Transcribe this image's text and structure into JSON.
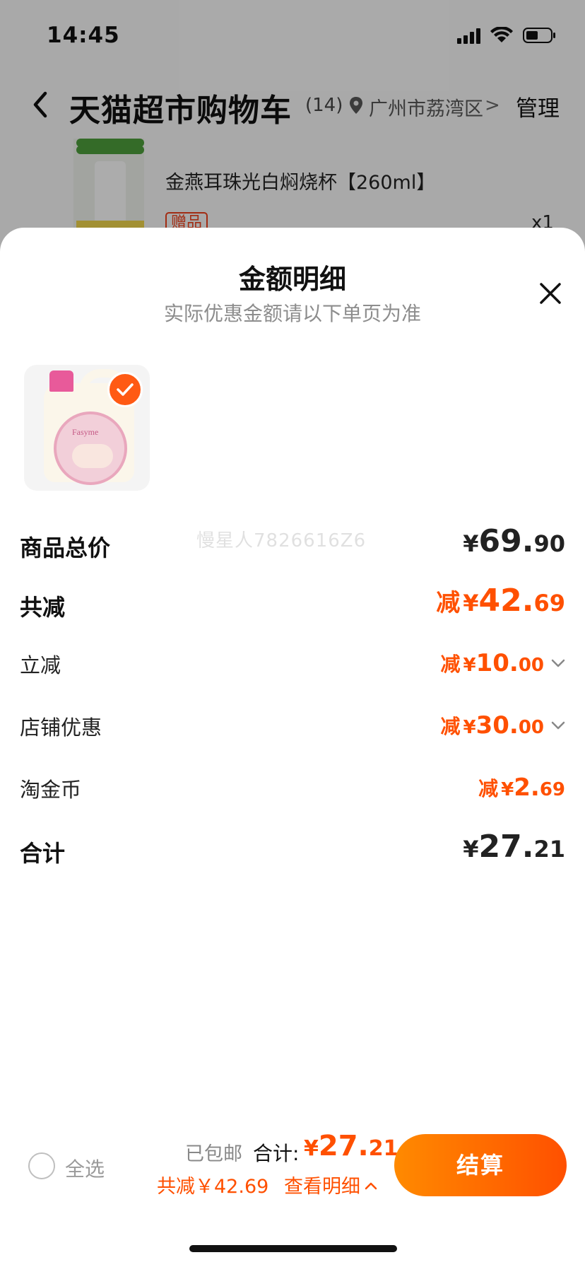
{
  "status_bar": {
    "time": "14:45"
  },
  "cart_header": {
    "title": "天猫超市购物车",
    "count": "(14)",
    "location": "广州市荔湾区",
    "location_chevron": ">",
    "manage": "管理"
  },
  "background_item": {
    "name": "金燕耳珠光白焖烧杯【260ml】",
    "tag": "赠品",
    "qty": "x1"
  },
  "sheet": {
    "title": "金额明细",
    "subtitle": "实际优惠金额请以下单页为准",
    "product_brand": "Fasyme",
    "watermark": "慢星人7826616Z6"
  },
  "breakdown": {
    "goods_total": {
      "label": "商品总价",
      "yen": "¥",
      "int": "69.",
      "dec": "90"
    },
    "total_discount": {
      "label": "共减",
      "minus": "减",
      "yen": "¥",
      "int": "42.",
      "dec": "69"
    },
    "instant_discount": {
      "label": "立减",
      "minus": "减",
      "yen": "¥",
      "int": "10.",
      "dec": "00"
    },
    "store_discount": {
      "label": "店铺优惠",
      "minus": "减",
      "yen": "¥",
      "int": "30.",
      "dec": "00"
    },
    "taojinbi": {
      "label": "淘金币",
      "minus": "减",
      "yen": "¥",
      "int": "2.",
      "dec": "69"
    },
    "total": {
      "label": "合计",
      "yen": "¥",
      "int": "27.",
      "dec": "21"
    }
  },
  "checkout": {
    "select_all": "全选",
    "shipping": "已包邮",
    "total_label": "合计:",
    "yen": "¥",
    "total_int": "27.",
    "total_dec": "21",
    "discount": "共减￥42.69",
    "view_detail": "查看明细",
    "button": "结算"
  },
  "colors": {
    "accent": "#ff5000",
    "accent_light": "#ff8a00",
    "text": "#111111",
    "muted": "#8d8d8d"
  }
}
